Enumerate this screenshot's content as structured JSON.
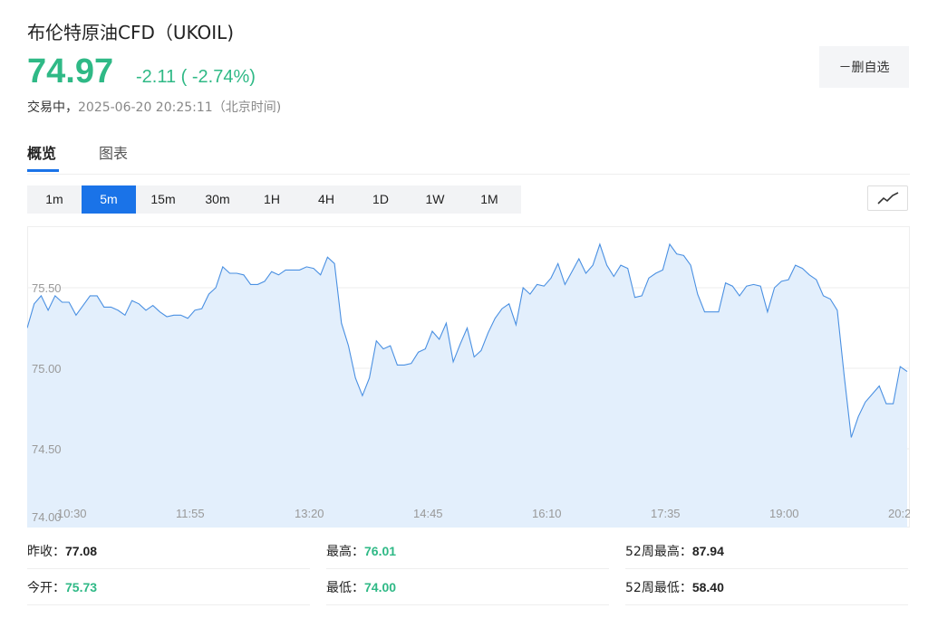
{
  "header": {
    "title": "布伦特原油CFD（UKOIL)",
    "price": "74.97",
    "change": "-2.11 ( -2.74%)",
    "status_label": "交易中，",
    "timestamp": "2025-06-20 20:25:11（北京时间)",
    "remove_button": "－删自选"
  },
  "tabs": [
    {
      "label": "概览",
      "active": true
    },
    {
      "label": "图表",
      "active": false
    }
  ],
  "periods": [
    {
      "label": "1m",
      "active": false
    },
    {
      "label": "5m",
      "active": true
    },
    {
      "label": "15m",
      "active": false
    },
    {
      "label": "30m",
      "active": false
    },
    {
      "label": "1H",
      "active": false
    },
    {
      "label": "4H",
      "active": false
    },
    {
      "label": "1D",
      "active": false
    },
    {
      "label": "1W",
      "active": false
    },
    {
      "label": "1M",
      "active": false
    }
  ],
  "chart_type_icon": "line-chart-icon",
  "colors": {
    "accent": "#1a73e8",
    "down_green": "#2fb986",
    "line": "#4a90e2",
    "fill": "#e3effc"
  },
  "chart_data": {
    "type": "area",
    "x_ticks": [
      "10:30",
      "11:55",
      "13:20",
      "14:45",
      "16:10",
      "17:35",
      "19:00",
      "20:2"
    ],
    "y_ticks": [
      "75.50",
      "75.00",
      "74.50",
      "74.00"
    ],
    "ylim": [
      74.0,
      76.0
    ],
    "grid": true,
    "values": [
      75.25,
      75.4,
      75.45,
      75.36,
      75.45,
      75.41,
      75.41,
      75.33,
      75.39,
      75.45,
      75.45,
      75.38,
      75.38,
      75.36,
      75.33,
      75.42,
      75.4,
      75.36,
      75.39,
      75.35,
      75.32,
      75.33,
      75.33,
      75.31,
      75.36,
      75.37,
      75.46,
      75.5,
      75.63,
      75.59,
      75.59,
      75.58,
      75.52,
      75.52,
      75.54,
      75.6,
      75.58,
      75.61,
      75.61,
      75.61,
      75.63,
      75.62,
      75.58,
      75.69,
      75.65,
      75.28,
      75.14,
      74.94,
      74.83,
      74.94,
      75.17,
      75.12,
      75.14,
      75.02,
      75.02,
      75.03,
      75.1,
      75.12,
      75.23,
      75.18,
      75.28,
      75.04,
      75.15,
      75.25,
      75.07,
      75.11,
      75.22,
      75.31,
      75.37,
      75.4,
      75.27,
      75.5,
      75.46,
      75.52,
      75.51,
      75.56,
      75.65,
      75.52,
      75.6,
      75.68,
      75.59,
      75.64,
      75.77,
      75.64,
      75.57,
      75.64,
      75.62,
      75.44,
      75.45,
      75.56,
      75.59,
      75.61,
      75.77,
      75.71,
      75.7,
      75.64,
      75.46,
      75.35,
      75.35,
      75.35,
      75.53,
      75.51,
      75.45,
      75.51,
      75.52,
      75.51,
      75.35,
      75.5,
      75.54,
      75.55,
      75.64,
      75.62,
      75.58,
      75.55,
      75.45,
      75.43,
      75.36,
      74.95,
      74.57,
      74.7,
      74.79,
      74.84,
      74.89,
      74.78,
      74.78,
      75.01,
      74.98
    ]
  },
  "stats": [
    {
      "label": "昨收：",
      "value": "77.08",
      "green": false
    },
    {
      "label": "最高：",
      "value": "76.01",
      "green": true
    },
    {
      "label": "52周最高：",
      "value": "87.94",
      "green": false
    },
    {
      "label": "今开：",
      "value": "75.73",
      "green": true
    },
    {
      "label": "最低：",
      "value": "74.00",
      "green": true
    },
    {
      "label": "52周最低：",
      "value": "58.40",
      "green": false
    }
  ]
}
